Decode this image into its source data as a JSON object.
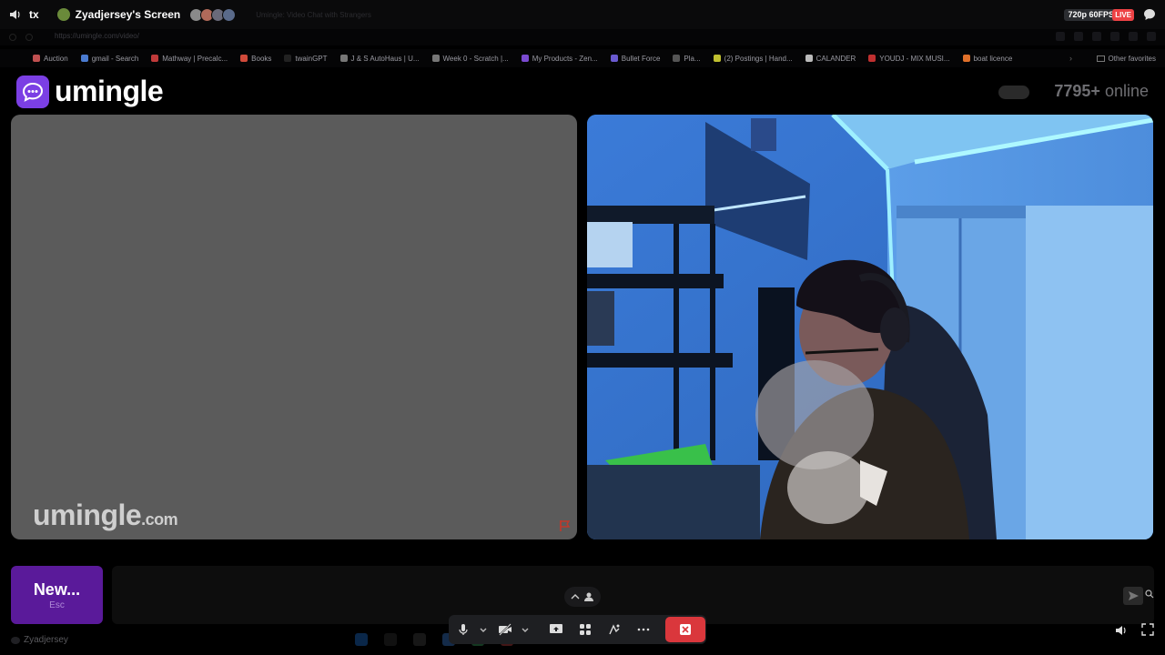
{
  "discord": {
    "channel": "tx",
    "stream_title": "Zyadjersey's Screen",
    "ghost_tab": "Umingle: Video Chat with Strangers",
    "quality": "720p 60FPS",
    "live": "LIVE",
    "chat_label": "Chat",
    "user_name": "Zyadjersey",
    "controls": [
      "microphone-icon",
      "chevron-down-icon",
      "camera-off-icon",
      "chevron-down-icon",
      "screen-share-icon",
      "activities-icon",
      "soundboard-icon",
      "more-icon",
      "hang-up-icon"
    ]
  },
  "browser": {
    "url": "https://umingle.com/video/",
    "bookmarks": [
      {
        "label": "Auction",
        "icon": "bookmark-icon",
        "color": "#c05050"
      },
      {
        "label": "gmail - Search",
        "icon": "search-icon",
        "color": "#4a7bd0"
      },
      {
        "label": "Mathway | Precalc...",
        "icon": "mathway-icon",
        "color": "#c03a3a"
      },
      {
        "label": "Books",
        "icon": "book-icon",
        "color": "#d04a3a"
      },
      {
        "label": "twainGPT",
        "icon": "gpt-icon",
        "color": "#222222"
      },
      {
        "label": "J & S AutoHaus | U...",
        "icon": "page-icon",
        "color": "#777777"
      },
      {
        "label": "Week 0 - Scratch |...",
        "icon": "arrow-icon",
        "color": "#777777"
      },
      {
        "label": "My Products - Zen...",
        "icon": "zen-icon",
        "color": "#7a4ad0"
      },
      {
        "label": "Bullet Force",
        "icon": "game-icon",
        "color": "#6a5ad0"
      },
      {
        "label": "Pla...",
        "icon": "page-icon",
        "color": "#555555"
      },
      {
        "label": "(2) Postings | Hand...",
        "icon": "handshake-icon",
        "color": "#c0c030"
      },
      {
        "label": "CALANDER",
        "icon": "calendar-icon",
        "color": "#bbbbbb"
      },
      {
        "label": "YOUDJ - MIX MUSI...",
        "icon": "dj-icon",
        "color": "#c03030"
      },
      {
        "label": "boat licence",
        "icon": "boat-icon",
        "color": "#e0702a"
      }
    ],
    "other_favorites": "Other favorites"
  },
  "umingle": {
    "logo": "umingle",
    "online_count": "7795+",
    "online_label": "online",
    "watermark_main": "umingle",
    "watermark_suffix": ".com",
    "new_button": "New...",
    "new_button_hint": "Esc"
  },
  "colors": {
    "brand_purple": "#7b3fe4",
    "new_button": "#5a1a9a",
    "live_red": "#ed4245",
    "hangup_red": "#da373c"
  }
}
